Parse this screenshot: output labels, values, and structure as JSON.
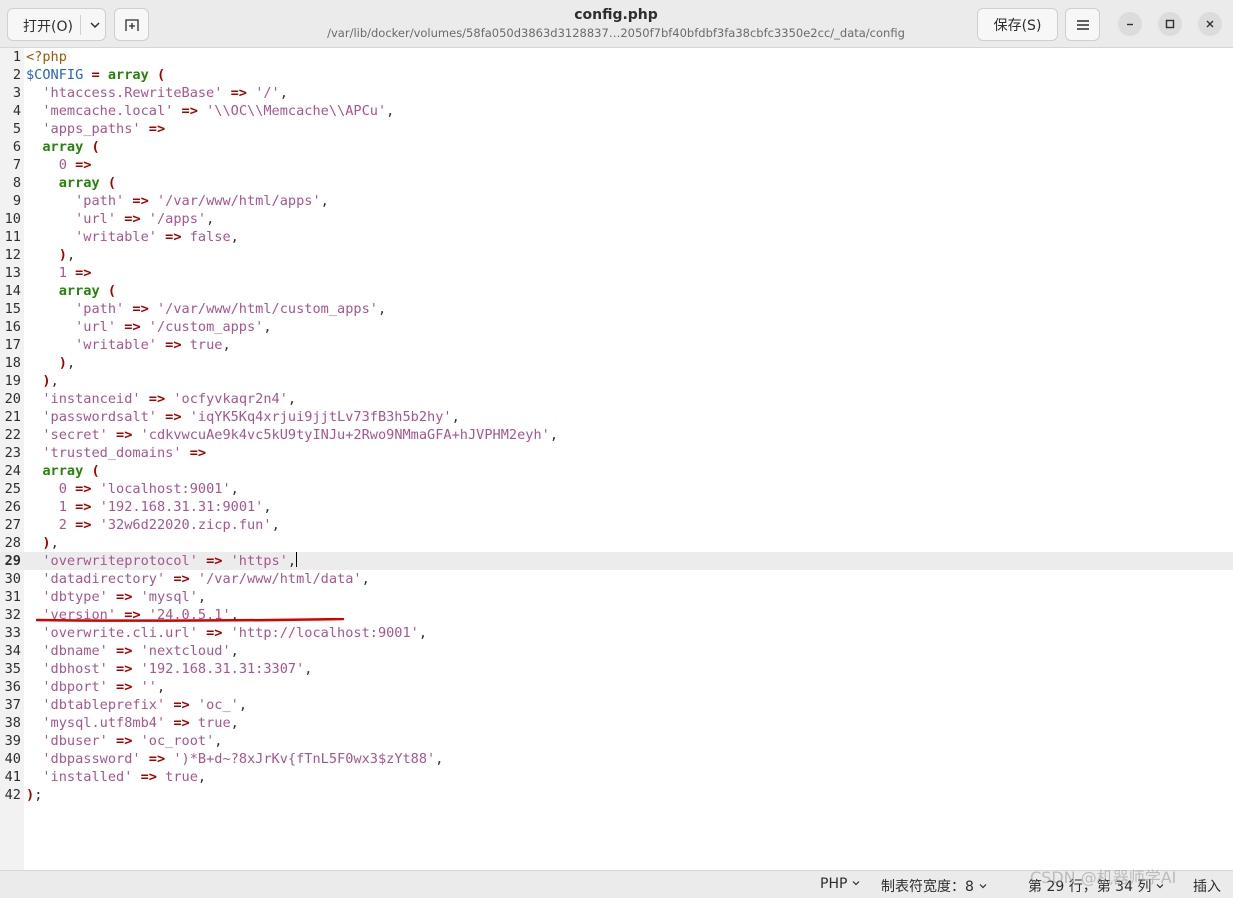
{
  "header": {
    "open_label": "打开(O)",
    "save_label": "保存(S)",
    "title": "config.php",
    "path": "/var/lib/docker/volumes/58fa050d3863d3128837…2050f7bf40bfdbf3fa38cbfc3350e2cc/_data/config"
  },
  "editor": {
    "current_line": 29,
    "lines": [
      [
        [
          "php",
          "<?php"
        ]
      ],
      [
        [
          "var",
          "$CONFIG"
        ],
        [
          "txt",
          " "
        ],
        [
          "op",
          "="
        ],
        [
          "txt",
          " "
        ],
        [
          "kw",
          "array"
        ],
        [
          "txt",
          " "
        ],
        [
          "op",
          "("
        ]
      ],
      [
        [
          "txt",
          "  "
        ],
        [
          "str",
          "'htaccess.RewriteBase'"
        ],
        [
          "txt",
          " "
        ],
        [
          "op",
          "=>"
        ],
        [
          "txt",
          " "
        ],
        [
          "str",
          "'/'"
        ],
        [
          "txt",
          ","
        ]
      ],
      [
        [
          "txt",
          "  "
        ],
        [
          "str",
          "'memcache.local'"
        ],
        [
          "txt",
          " "
        ],
        [
          "op",
          "=>"
        ],
        [
          "txt",
          " "
        ],
        [
          "str",
          "'\\\\OC\\\\Memcache\\\\APCu'"
        ],
        [
          "txt",
          ","
        ]
      ],
      [
        [
          "txt",
          "  "
        ],
        [
          "str",
          "'apps_paths'"
        ],
        [
          "txt",
          " "
        ],
        [
          "op",
          "=>"
        ]
      ],
      [
        [
          "txt",
          "  "
        ],
        [
          "kw",
          "array"
        ],
        [
          "txt",
          " "
        ],
        [
          "op",
          "("
        ]
      ],
      [
        [
          "txt",
          "    "
        ],
        [
          "num",
          "0"
        ],
        [
          "txt",
          " "
        ],
        [
          "op",
          "=>"
        ]
      ],
      [
        [
          "txt",
          "    "
        ],
        [
          "kw",
          "array"
        ],
        [
          "txt",
          " "
        ],
        [
          "op",
          "("
        ]
      ],
      [
        [
          "txt",
          "      "
        ],
        [
          "str",
          "'path'"
        ],
        [
          "txt",
          " "
        ],
        [
          "op",
          "=>"
        ],
        [
          "txt",
          " "
        ],
        [
          "str",
          "'/var/www/html/apps'"
        ],
        [
          "txt",
          ","
        ]
      ],
      [
        [
          "txt",
          "      "
        ],
        [
          "str",
          "'url'"
        ],
        [
          "txt",
          " "
        ],
        [
          "op",
          "=>"
        ],
        [
          "txt",
          " "
        ],
        [
          "str",
          "'/apps'"
        ],
        [
          "txt",
          ","
        ]
      ],
      [
        [
          "txt",
          "      "
        ],
        [
          "str",
          "'writable'"
        ],
        [
          "txt",
          " "
        ],
        [
          "op",
          "=>"
        ],
        [
          "txt",
          " "
        ],
        [
          "bool",
          "false"
        ],
        [
          "txt",
          ","
        ]
      ],
      [
        [
          "txt",
          "    "
        ],
        [
          "op",
          ")"
        ],
        [
          "txt",
          ","
        ]
      ],
      [
        [
          "txt",
          "    "
        ],
        [
          "num",
          "1"
        ],
        [
          "txt",
          " "
        ],
        [
          "op",
          "=>"
        ]
      ],
      [
        [
          "txt",
          "    "
        ],
        [
          "kw",
          "array"
        ],
        [
          "txt",
          " "
        ],
        [
          "op",
          "("
        ]
      ],
      [
        [
          "txt",
          "      "
        ],
        [
          "str",
          "'path'"
        ],
        [
          "txt",
          " "
        ],
        [
          "op",
          "=>"
        ],
        [
          "txt",
          " "
        ],
        [
          "str",
          "'/var/www/html/custom_apps'"
        ],
        [
          "txt",
          ","
        ]
      ],
      [
        [
          "txt",
          "      "
        ],
        [
          "str",
          "'url'"
        ],
        [
          "txt",
          " "
        ],
        [
          "op",
          "=>"
        ],
        [
          "txt",
          " "
        ],
        [
          "str",
          "'/custom_apps'"
        ],
        [
          "txt",
          ","
        ]
      ],
      [
        [
          "txt",
          "      "
        ],
        [
          "str",
          "'writable'"
        ],
        [
          "txt",
          " "
        ],
        [
          "op",
          "=>"
        ],
        [
          "txt",
          " "
        ],
        [
          "bool",
          "true"
        ],
        [
          "txt",
          ","
        ]
      ],
      [
        [
          "txt",
          "    "
        ],
        [
          "op",
          ")"
        ],
        [
          "txt",
          ","
        ]
      ],
      [
        [
          "txt",
          "  "
        ],
        [
          "op",
          ")"
        ],
        [
          "txt",
          ","
        ]
      ],
      [
        [
          "txt",
          "  "
        ],
        [
          "str",
          "'instanceid'"
        ],
        [
          "txt",
          " "
        ],
        [
          "op",
          "=>"
        ],
        [
          "txt",
          " "
        ],
        [
          "str",
          "'ocfyvkaqr2n4'"
        ],
        [
          "txt",
          ","
        ]
      ],
      [
        [
          "txt",
          "  "
        ],
        [
          "str",
          "'passwordsalt'"
        ],
        [
          "txt",
          " "
        ],
        [
          "op",
          "=>"
        ],
        [
          "txt",
          " "
        ],
        [
          "str",
          "'iqYK5Kq4xrjui9jjtLv73fB3h5b2hy'"
        ],
        [
          "txt",
          ","
        ]
      ],
      [
        [
          "txt",
          "  "
        ],
        [
          "str",
          "'secret'"
        ],
        [
          "txt",
          " "
        ],
        [
          "op",
          "=>"
        ],
        [
          "txt",
          " "
        ],
        [
          "str",
          "'cdkvwcuAe9k4vc5kU9tyINJu+2Rwo9NMmaGFA+hJVPHM2eyh'"
        ],
        [
          "txt",
          ","
        ]
      ],
      [
        [
          "txt",
          "  "
        ],
        [
          "str",
          "'trusted_domains'"
        ],
        [
          "txt",
          " "
        ],
        [
          "op",
          "=>"
        ]
      ],
      [
        [
          "txt",
          "  "
        ],
        [
          "kw",
          "array"
        ],
        [
          "txt",
          " "
        ],
        [
          "op",
          "("
        ]
      ],
      [
        [
          "txt",
          "    "
        ],
        [
          "num",
          "0"
        ],
        [
          "txt",
          " "
        ],
        [
          "op",
          "=>"
        ],
        [
          "txt",
          " "
        ],
        [
          "str",
          "'localhost:9001'"
        ],
        [
          "txt",
          ","
        ]
      ],
      [
        [
          "txt",
          "    "
        ],
        [
          "num",
          "1"
        ],
        [
          "txt",
          " "
        ],
        [
          "op",
          "=>"
        ],
        [
          "txt",
          " "
        ],
        [
          "str",
          "'192.168.31.31:9001'"
        ],
        [
          "txt",
          ","
        ]
      ],
      [
        [
          "txt",
          "    "
        ],
        [
          "num",
          "2"
        ],
        [
          "txt",
          " "
        ],
        [
          "op",
          "=>"
        ],
        [
          "txt",
          " "
        ],
        [
          "str",
          "'32w6d22020.zicp.fun'"
        ],
        [
          "txt",
          ","
        ]
      ],
      [
        [
          "txt",
          "  "
        ],
        [
          "op",
          ")"
        ],
        [
          "txt",
          ","
        ]
      ],
      [
        [
          "txt",
          "  "
        ],
        [
          "str",
          "'overwriteprotocol'"
        ],
        [
          "txt",
          " "
        ],
        [
          "op",
          "=>"
        ],
        [
          "txt",
          " "
        ],
        [
          "str",
          "'https'"
        ],
        [
          "txt",
          ","
        ]
      ],
      [
        [
          "txt",
          "  "
        ],
        [
          "str",
          "'datadirectory'"
        ],
        [
          "txt",
          " "
        ],
        [
          "op",
          "=>"
        ],
        [
          "txt",
          " "
        ],
        [
          "str",
          "'/var/www/html/data'"
        ],
        [
          "txt",
          ","
        ]
      ],
      [
        [
          "txt",
          "  "
        ],
        [
          "str",
          "'dbtype'"
        ],
        [
          "txt",
          " "
        ],
        [
          "op",
          "=>"
        ],
        [
          "txt",
          " "
        ],
        [
          "str",
          "'mysql'"
        ],
        [
          "txt",
          ","
        ]
      ],
      [
        [
          "txt",
          "  "
        ],
        [
          "str",
          "'version'"
        ],
        [
          "txt",
          " "
        ],
        [
          "op",
          "=>"
        ],
        [
          "txt",
          " "
        ],
        [
          "str",
          "'24.0.5.1'"
        ],
        [
          "txt",
          ","
        ]
      ],
      [
        [
          "txt",
          "  "
        ],
        [
          "str",
          "'overwrite.cli.url'"
        ],
        [
          "txt",
          " "
        ],
        [
          "op",
          "=>"
        ],
        [
          "txt",
          " "
        ],
        [
          "str",
          "'http://localhost:9001'"
        ],
        [
          "txt",
          ","
        ]
      ],
      [
        [
          "txt",
          "  "
        ],
        [
          "str",
          "'dbname'"
        ],
        [
          "txt",
          " "
        ],
        [
          "op",
          "=>"
        ],
        [
          "txt",
          " "
        ],
        [
          "str",
          "'nextcloud'"
        ],
        [
          "txt",
          ","
        ]
      ],
      [
        [
          "txt",
          "  "
        ],
        [
          "str",
          "'dbhost'"
        ],
        [
          "txt",
          " "
        ],
        [
          "op",
          "=>"
        ],
        [
          "txt",
          " "
        ],
        [
          "str",
          "'192.168.31.31:3307'"
        ],
        [
          "txt",
          ","
        ]
      ],
      [
        [
          "txt",
          "  "
        ],
        [
          "str",
          "'dbport'"
        ],
        [
          "txt",
          " "
        ],
        [
          "op",
          "=>"
        ],
        [
          "txt",
          " "
        ],
        [
          "str",
          "''"
        ],
        [
          "txt",
          ","
        ]
      ],
      [
        [
          "txt",
          "  "
        ],
        [
          "str",
          "'dbtableprefix'"
        ],
        [
          "txt",
          " "
        ],
        [
          "op",
          "=>"
        ],
        [
          "txt",
          " "
        ],
        [
          "str",
          "'oc_'"
        ],
        [
          "txt",
          ","
        ]
      ],
      [
        [
          "txt",
          "  "
        ],
        [
          "str",
          "'mysql.utf8mb4'"
        ],
        [
          "txt",
          " "
        ],
        [
          "op",
          "=>"
        ],
        [
          "txt",
          " "
        ],
        [
          "bool",
          "true"
        ],
        [
          "txt",
          ","
        ]
      ],
      [
        [
          "txt",
          "  "
        ],
        [
          "str",
          "'dbuser'"
        ],
        [
          "txt",
          " "
        ],
        [
          "op",
          "=>"
        ],
        [
          "txt",
          " "
        ],
        [
          "str",
          "'oc_root'"
        ],
        [
          "txt",
          ","
        ]
      ],
      [
        [
          "txt",
          "  "
        ],
        [
          "str",
          "'dbpassword'"
        ],
        [
          "txt",
          " "
        ],
        [
          "op",
          "=>"
        ],
        [
          "txt",
          " "
        ],
        [
          "str",
          "')*B+d~?8xJrKv{fTnL5F0wx3$zYt88'"
        ],
        [
          "txt",
          ","
        ]
      ],
      [
        [
          "txt",
          "  "
        ],
        [
          "str",
          "'installed'"
        ],
        [
          "txt",
          " "
        ],
        [
          "op",
          "=>"
        ],
        [
          "txt",
          " "
        ],
        [
          "bool",
          "true"
        ],
        [
          "txt",
          ","
        ]
      ],
      [
        [
          "op",
          ")"
        ],
        [
          "txt",
          ";"
        ]
      ]
    ]
  },
  "status": {
    "language": "PHP",
    "tab_width": "制表符宽度：8",
    "position": "第 29 行，第 34 列",
    "mode": "插入"
  },
  "watermark": "CSDN @机器师学AI",
  "colors": {
    "string": "#a6578e",
    "keyword": "#268406",
    "operator": "#a50000",
    "variable": "#2864b8",
    "annotation_underline": "#d40000"
  }
}
